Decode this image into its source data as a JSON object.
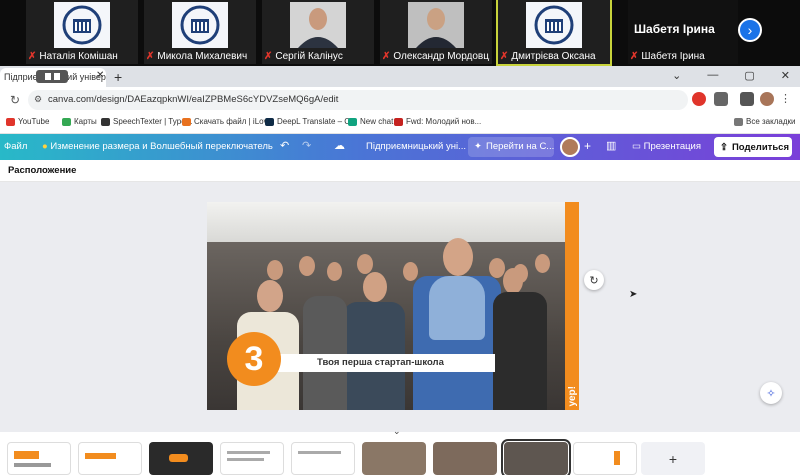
{
  "zoom": {
    "participants": [
      {
        "name": "Наталія Комішан",
        "kind": "logo",
        "muted": true
      },
      {
        "name": "Микола Михалевич",
        "kind": "logo",
        "muted": true
      },
      {
        "name": "Сергій Калінус",
        "kind": "person",
        "muted": true
      },
      {
        "name": "Олександр Мордовц...",
        "kind": "person",
        "muted": true
      },
      {
        "name": "Дмитрієва Оксана",
        "kind": "logo",
        "muted": true,
        "active": true
      }
    ],
    "name_only": {
      "title": "Шабетя Ірина",
      "caption": "Шабетя Ірина"
    },
    "next_icon": "chevron-right-icon"
  },
  "browser": {
    "tab_title": "Підприємницький університет",
    "url": "canva.com/design/DAEazqpknWI/eaIZPBMeS6cYDVZseMQ6gA/edit",
    "bookmarks": [
      "YouTube",
      "Карты",
      "SpeechTexter | Type...",
      "Скачать файл | iLov...",
      "DeepL Translate – С...",
      "New chat",
      "Fwd: Молодий нов..."
    ],
    "all_bookmarks": "Все закладки"
  },
  "canva": {
    "file_menu": "Файл",
    "resize_label": "Изменение размера и Волшебный переключатель",
    "design_title": "Підприємницький уні...",
    "go_to_label": "Перейти на С...",
    "present_label": "Презентация",
    "share_label": "Поделиться",
    "position_label": "Расположение",
    "slide_number": "3",
    "slide_caption": "Твоя перша стартап-школа",
    "slide_side_text": "уер!"
  },
  "colors": {
    "accent_orange": "#f28c1e",
    "canva_start": "#28b9c8",
    "canva_end": "#7a3fd9",
    "zoom_active": "#c8d33b"
  }
}
